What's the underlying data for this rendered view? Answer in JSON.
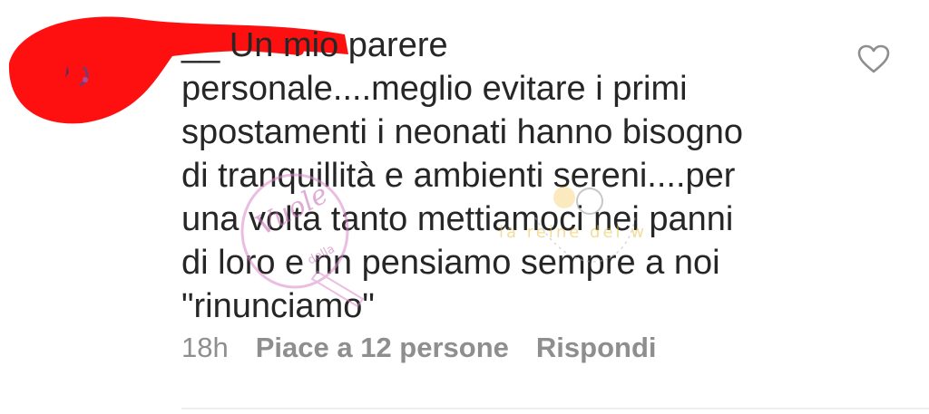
{
  "comment": {
    "username_visible": "__",
    "text_lines": [
      "Un mio parere",
      "personale....meglio evitare i primi",
      "spostamenti i neonati hanno bisogno",
      "di tranquillità e ambienti sereni....per",
      "una volta tanto mettiamoci nei panni",
      "di loro e nn pensiamo sempre a noi",
      "\"rinunciamo\""
    ],
    "timestamp": "18h",
    "likes_label": "Piace a 12 persone",
    "reply_label": "Rispondi"
  },
  "icons": {
    "like": "heart-outline-icon",
    "avatar": "avatar"
  },
  "watermark": {
    "script_text": "Vuole",
    "small_text": "della",
    "banner_text": "la reine del web"
  },
  "colors": {
    "text": "#262626",
    "meta": "#8e8e8e",
    "redaction": "#ff1010",
    "icon": "#8e8e8e"
  }
}
